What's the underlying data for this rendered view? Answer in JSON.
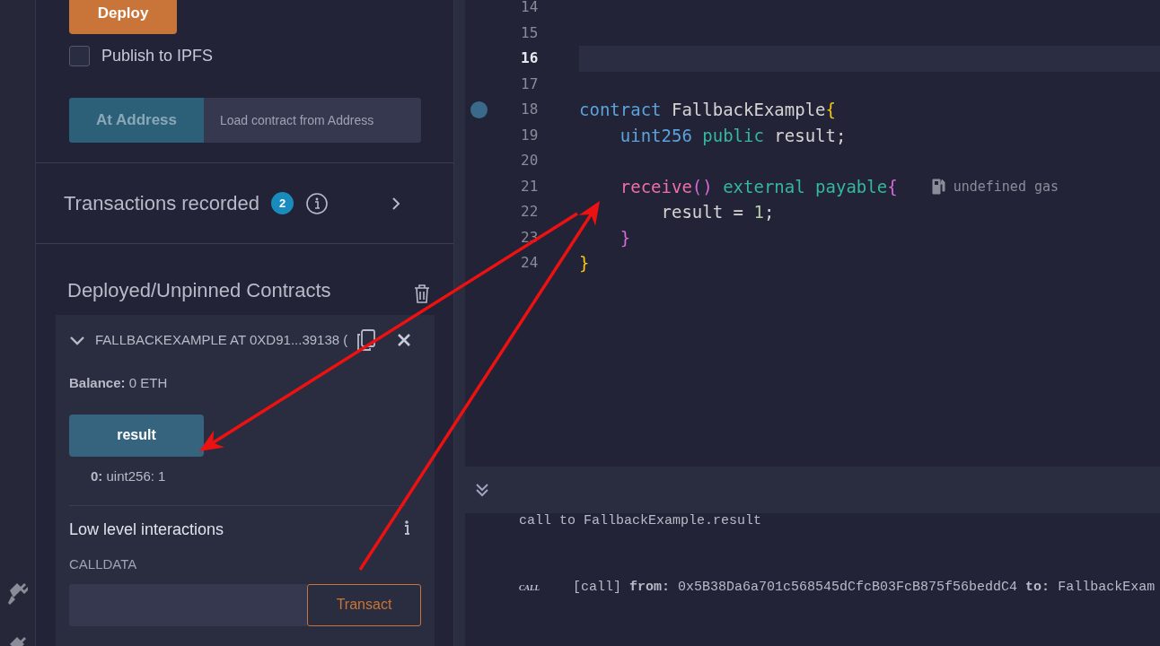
{
  "deploy_panel": {
    "deploy_button": "Deploy",
    "publish_ipfs": {
      "label": "Publish to IPFS",
      "checked": false
    },
    "at_address": {
      "button": "At Address",
      "placeholder": "Load contract from Address"
    }
  },
  "transactions_recorded": {
    "title": "Transactions recorded",
    "count": "2"
  },
  "deployed_contracts": {
    "title": "Deployed/Unpinned Contracts",
    "instances": [
      {
        "title": "FALLBACKEXAMPLE AT 0XD91...39138 (",
        "expanded": true,
        "balance_label": "Balance:",
        "balance": "0 ETH",
        "functions": [
          {
            "name": "result",
            "output_index": "0:",
            "output": "uint256: 1"
          }
        ],
        "low_level": {
          "title": "Low level interactions",
          "calldata_label": "CALLDATA",
          "button": "Transact"
        }
      }
    ]
  },
  "editor": {
    "lines": [
      {
        "number": "14",
        "current": false,
        "breakpoint": false
      },
      {
        "number": "15",
        "current": false,
        "breakpoint": false
      },
      {
        "number": "16",
        "current": true,
        "breakpoint": false
      },
      {
        "number": "17",
        "current": false,
        "breakpoint": false
      },
      {
        "number": "18",
        "current": false,
        "breakpoint": true,
        "tokens": [
          {
            "kind": "keyword",
            "text": "contract"
          },
          {
            "kind": "plain",
            "text": " FallbackExample"
          },
          {
            "kind": "bracket1",
            "text": "{"
          }
        ],
        "children": [
          {
            "number": "19",
            "current": false,
            "breakpoint": false,
            "tokens": [
              {
                "kind": "keyword",
                "text": "uint256 "
              },
              {
                "kind": "modifier",
                "text": "public"
              },
              {
                "kind": "plain",
                "text": " result;"
              }
            ]
          },
          {
            "number": "20",
            "current": false,
            "breakpoint": false
          },
          {
            "number": "21",
            "current": false,
            "breakpoint": false,
            "hint": "undefined gas",
            "tokens": [
              {
                "kind": "function",
                "text": "receive"
              },
              {
                "kind": "bracket2",
                "text": "() "
              },
              {
                "kind": "modifier",
                "text": "external payable"
              },
              {
                "kind": "bracket2",
                "text": "{"
              }
            ],
            "children": [
              {
                "number": "22",
                "current": false,
                "breakpoint": false,
                "tokens": [
                  {
                    "kind": "plain",
                    "text": "result = "
                  },
                  {
                    "kind": "number",
                    "text": "1"
                  },
                  {
                    "kind": "plain",
                    "text": ";"
                  }
                ]
              }
            ]
          },
          {
            "number": "23",
            "current": false,
            "breakpoint": false,
            "tokens": [
              {
                "kind": "bracket2",
                "text": "}"
              }
            ]
          }
        ]
      },
      {
        "number": "24",
        "current": false,
        "breakpoint": false,
        "tokens": [
          {
            "kind": "bracket1",
            "text": "}"
          }
        ]
      }
    ]
  },
  "terminal": {
    "entries": [
      {
        "kind": "text",
        "text": "call to FallbackExample.result"
      },
      {
        "kind": "call",
        "badge": "CALL",
        "tag": "[call]",
        "from_label": "from:",
        "from": "0x5B38Da6a701c568545dCfcB03FcB875f56beddC4",
        "to_label": "to:",
        "to": "FallbackExam"
      }
    ]
  }
}
